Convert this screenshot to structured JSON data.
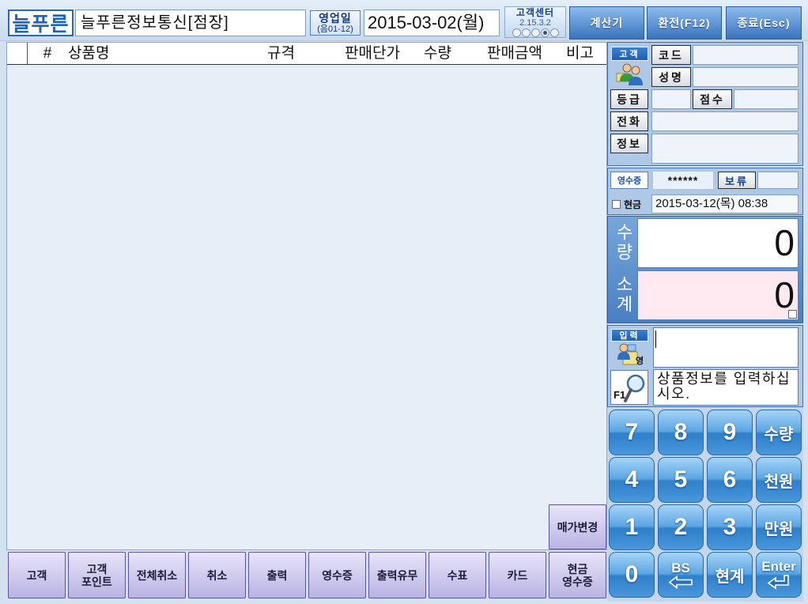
{
  "header": {
    "logo": "늘푸른",
    "store_name": "늘푸른정보통신[점장]",
    "business_day": {
      "label": "영업일",
      "lunar": "(음01-12)"
    },
    "business_date": "2015-03-02(월)",
    "support_center": {
      "label": "고객센터",
      "version": "2.15.3.2",
      "status_lights": [
        false,
        false,
        false,
        true,
        false
      ]
    },
    "buttons": {
      "calculator": "계산기",
      "exchange": "환전(F12)",
      "exit": "종료(Esc)"
    }
  },
  "grid": {
    "columns": [
      "#",
      "상품명",
      "규격",
      "판매단가",
      "수량",
      "판매금액",
      "비고"
    ],
    "rows": []
  },
  "price_change_button": "매가변경",
  "function_buttons": [
    "고객",
    "고객\n포인트",
    "전체취소",
    "취소",
    "출력",
    "영수증",
    "출력유무",
    "수표",
    "카드",
    "현금\n영수증"
  ],
  "customer": {
    "badge": "고객",
    "icon": "customer-group-icon",
    "code": {
      "label": "코드",
      "value": ""
    },
    "name": {
      "label": "성명",
      "value": ""
    },
    "grade": {
      "label": "등급",
      "value": ""
    },
    "points": {
      "label": "점수",
      "value": ""
    },
    "phone": {
      "label": "전화",
      "value": ""
    },
    "info": {
      "label": "정보",
      "value": ""
    }
  },
  "receipt": {
    "label": "영수증",
    "number": "******",
    "hold_button": "보류",
    "hold_value": ""
  },
  "cash": {
    "label": "현금",
    "checked": false,
    "datetime": "2015-03-12(목) 08:38"
  },
  "totals": {
    "quantity_label": "수량",
    "quantity": "0",
    "subtotal_label": "소계",
    "subtotal": "0",
    "subtotal_checked": false
  },
  "input": {
    "badge": "입력",
    "icon": "member-card-icon",
    "icon_text": "영",
    "value": "",
    "search_key": "F1",
    "search_icon": "magnifier-icon",
    "message": "상품정보를 입력하십시오."
  },
  "keypad": [
    [
      "7",
      "8",
      "9",
      "수량"
    ],
    [
      "4",
      "5",
      "6",
      "천원"
    ],
    [
      "1",
      "2",
      "3",
      "만원"
    ],
    [
      "0",
      "BS",
      "현계",
      "Enter"
    ]
  ],
  "colors": {
    "keypad_button": "#3b8ad2",
    "function_button": "#c6c1ea",
    "top_button": "#4a82c6",
    "subtotal_background": "#fde9ef",
    "logo_text": "#1c62c0"
  }
}
